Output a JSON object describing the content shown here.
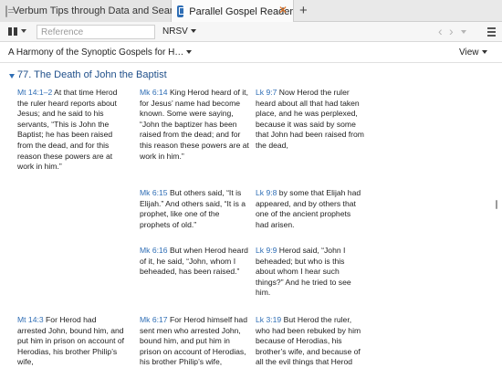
{
  "tabs": [
    {
      "label": "Verbum Tips through Data and Search",
      "active": false
    },
    {
      "label": "Parallel Gospel Reader",
      "active": true,
      "close": "✕"
    }
  ],
  "new_tab": "+",
  "toolbar": {
    "reference_placeholder": "Reference",
    "version": "NRSV",
    "back_icon": "chevron-left-icon",
    "forward_icon": "chevron-right-icon"
  },
  "header": {
    "title": "A Harmony of the Synoptic Gospels for H…",
    "view": "View"
  },
  "section": {
    "heading": "77. The Death of John the Baptist"
  },
  "rows": [
    [
      {
        "ref": "Mt 14:1–2",
        "text": " At that time Herod the ruler heard reports about Jesus; and he said to his servants, “This is John the Baptist; he has been raised from the dead, and for this reason these powers are at work in him.”"
      },
      {
        "ref": "Mk 6:14",
        "text": " King Herod heard of it, for Jesus’ name had become known. Some were saying, “John the baptizer has been raised from the dead; and for this reason these powers are at work in him.”"
      },
      {
        "ref": "Lk 9:7",
        "text": " Now Herod the ruler heard about all that had taken place, and he was perplexed, because it was said by some that John had been raised from the dead,"
      }
    ],
    [
      {
        "ref": "",
        "text": ""
      },
      {
        "ref": "Mk 6:15",
        "text": " But others said, “It is Elijah.” And others said, “It is a prophet, like one of the prophets of old.”"
      },
      {
        "ref": "Lk 9:8",
        "text": " by some that Elijah had appeared, and by others that one of the ancient prophets had arisen."
      }
    ],
    [
      {
        "ref": "",
        "text": ""
      },
      {
        "ref": "Mk 6:16",
        "text": " But when Herod heard of it, he said, “John, whom I beheaded, has been raised.”"
      },
      {
        "ref": "Lk 9:9",
        "text": " Herod said, “John I beheaded; but who is this about whom I hear such things?” And he tried to see him."
      }
    ],
    [
      {
        "ref": "Mt 14:3",
        "text": " For Herod had arrested John, bound him, and put him in prison on account of Herodias, his brother Philip’s wife,"
      },
      {
        "ref": "Mk 6:17",
        "text": " For Herod himself had sent men who arrested John, bound him, and put him in prison on account of Herodias, his brother Philip’s wife,"
      },
      {
        "ref": "Lk 3:19",
        "text": " But Herod the ruler, who had been rebuked by him because of Herodias, his brother’s wife, and because of all the evil things that Herod"
      }
    ]
  ]
}
